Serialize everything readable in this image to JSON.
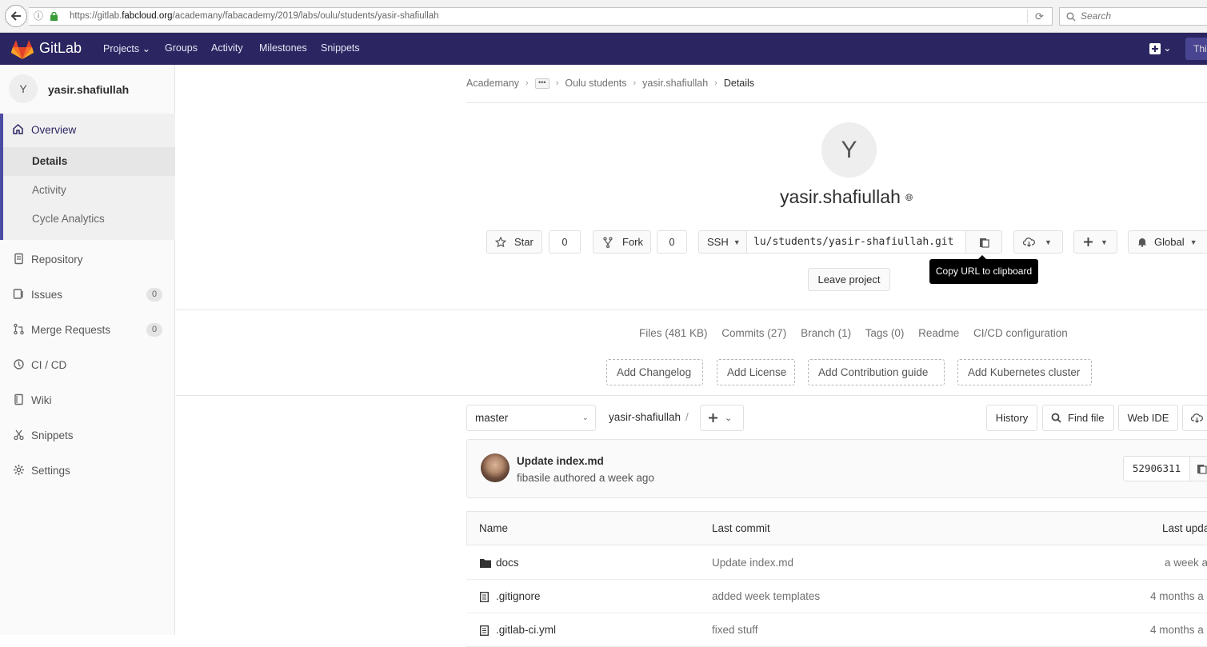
{
  "browser": {
    "url_prefix": "https://gitlab.",
    "url_domain": "fabcloud.org",
    "url_path": "/academany/fabacademy/2019/labs/oulu/students/yasir-shafiullah",
    "search_placeholder": "Search"
  },
  "topnav": {
    "brand": "GitLab",
    "links": [
      "Projects",
      "Groups",
      "Activity",
      "Milestones",
      "Snippets"
    ],
    "user_label": "Thi"
  },
  "sidebar": {
    "avatar_letter": "Y",
    "project_name": "yasir.shafiullah",
    "overview": "Overview",
    "sub_items": [
      "Details",
      "Activity",
      "Cycle Analytics"
    ],
    "items": [
      {
        "label": "Repository",
        "count": ""
      },
      {
        "label": "Issues",
        "count": "0"
      },
      {
        "label": "Merge Requests",
        "count": "0"
      },
      {
        "label": "CI / CD",
        "count": ""
      },
      {
        "label": "Wiki",
        "count": ""
      },
      {
        "label": "Snippets",
        "count": ""
      },
      {
        "label": "Settings",
        "count": ""
      }
    ]
  },
  "breadcrumb": [
    "Academany",
    "Oulu students",
    "yasir.shafiullah",
    "Details"
  ],
  "project": {
    "avatar_letter": "Y",
    "title": "yasir.shafiullah",
    "star_label": "Star",
    "star_count": "0",
    "fork_label": "Fork",
    "fork_count": "0",
    "protocol": "SSH",
    "clone_url": "lu/students/yasir-shafiullah.git",
    "tooltip": "Copy URL to clipboard",
    "notification": "Global",
    "leave_label": "Leave project"
  },
  "stats": [
    "Files (481 KB)",
    "Commits (27)",
    "Branch (1)",
    "Tags (0)",
    "Readme",
    "CI/CD configuration"
  ],
  "add_buttons": [
    "Add Changelog",
    "Add License",
    "Add Contribution guide",
    "Add Kubernetes cluster"
  ],
  "repo": {
    "branch": "master",
    "path": "yasir-shafiullah",
    "history": "History",
    "find_file": "Find file",
    "web_ide": "Web IDE"
  },
  "commit": {
    "title": "Update index.md",
    "meta": "fibasile authored a week ago",
    "sha": "52906311"
  },
  "files": {
    "headers": [
      "Name",
      "Last commit",
      "Last upda"
    ],
    "rows": [
      {
        "name": "docs",
        "type": "folder",
        "commit": "Update index.md",
        "updated": "a week a"
      },
      {
        "name": ".gitignore",
        "type": "file",
        "commit": "added week templates",
        "updated": "4 months a"
      },
      {
        "name": ".gitlab-ci.yml",
        "type": "file",
        "commit": "fixed stuff",
        "updated": "4 months a"
      }
    ]
  },
  "colors": {
    "nav_bg": "#2b2561",
    "sidebar_accent": "#4b4ba3"
  }
}
